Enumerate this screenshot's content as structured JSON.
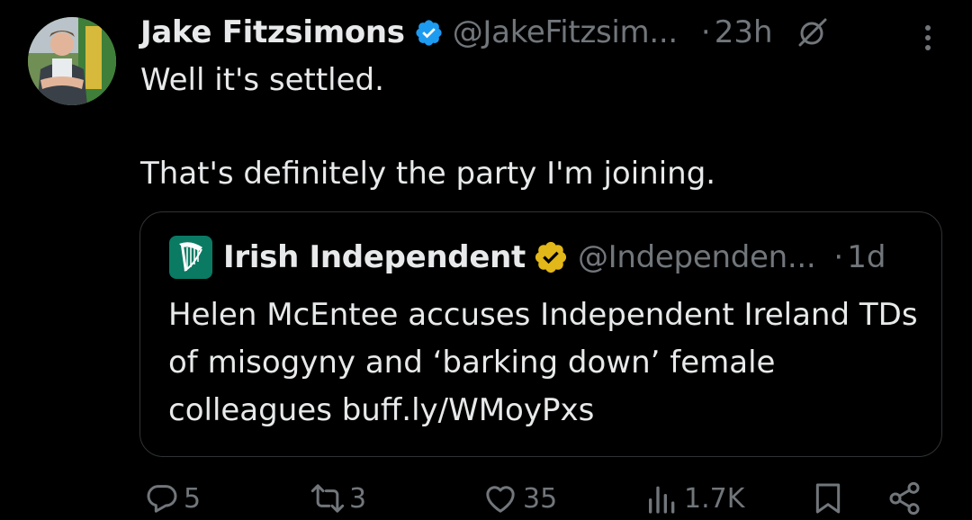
{
  "tweet": {
    "author_name": "Jake Fitzsimons",
    "author_handle": "@JakeFitzsim...",
    "separator": "·",
    "time": "23h",
    "text_line1": "Well it's settled.",
    "text_line2": "That's definitely the party I'm joining."
  },
  "quoted": {
    "author_name": "Irish Independent",
    "author_handle": "@Independen...",
    "separator": "·",
    "time": "1d",
    "text": "Helen McEntee accuses Independent Ireland TDs of misogyny and ‘barking down’ female colleagues buff.ly/WMoyPxs"
  },
  "actions": {
    "replies": "5",
    "reposts": "3",
    "likes": "35",
    "views": "1.7K"
  },
  "colors": {
    "background": "#000000",
    "text": "#e7e9ea",
    "muted": "#71767b",
    "blue_badge": "#1d9bf0",
    "gold_badge": "#e2b719",
    "border": "#2f3336"
  },
  "icons": [
    "verified-badge-icon",
    "grok-icon",
    "more-icon",
    "harp-logo-icon",
    "gold-verified-badge-icon",
    "reply-icon",
    "repost-icon",
    "like-icon",
    "views-icon",
    "bookmark-icon",
    "share-icon"
  ]
}
